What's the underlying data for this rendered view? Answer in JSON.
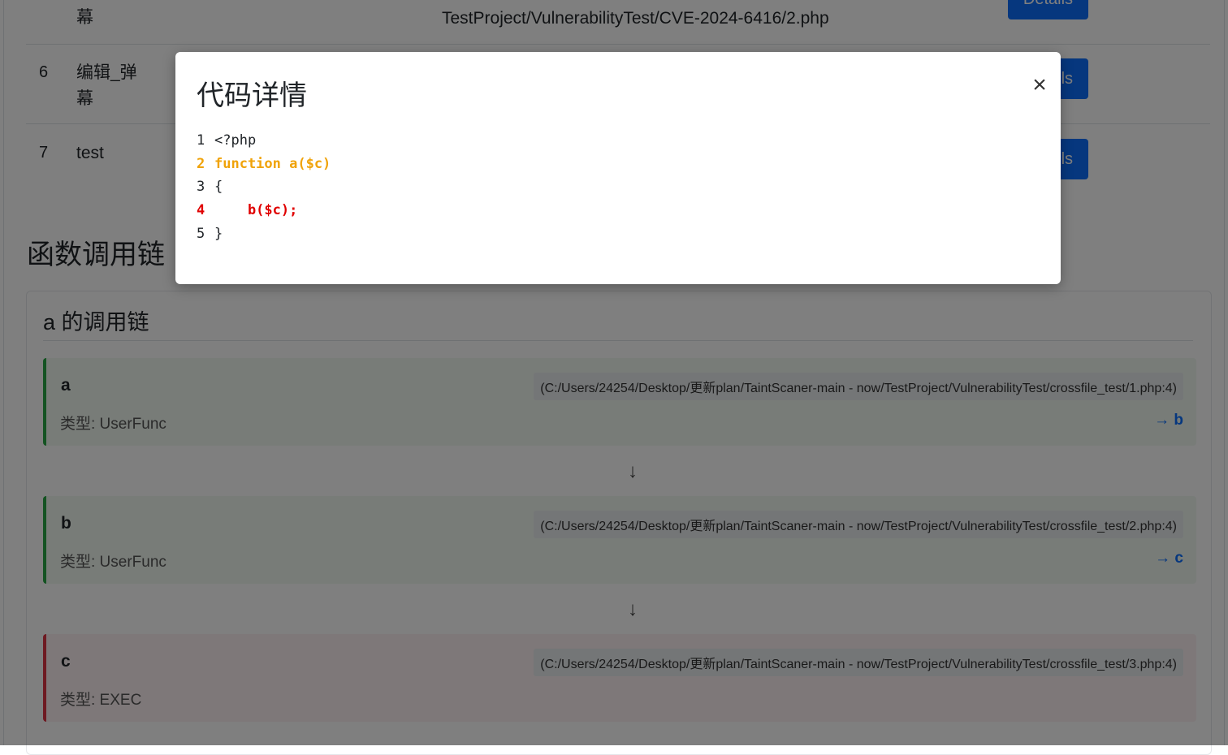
{
  "table": {
    "top_row": {
      "name_tail": "幕",
      "path": "TestProject/VulnerabilityTest/CVE-2024-6416/2.php",
      "button": "Details"
    },
    "rows": [
      {
        "num": "6",
        "name_line1": "编辑_弹",
        "name_line2": "幕",
        "button": "Details"
      },
      {
        "num": "7",
        "name_line1": "test",
        "name_line2": "",
        "button": "Details"
      }
    ]
  },
  "section_title": "函数调用链",
  "chain": {
    "title": "a 的调用链",
    "nodes": [
      {
        "name": "a",
        "path": "(C:/Users/24254/Desktop/更新plan/TaintScaner-main - now/TestProject/VulnerabilityTest/crossfile_test/1.php:4)",
        "type": "类型: UserFunc",
        "next": "→ b"
      },
      {
        "name": "b",
        "path": "(C:/Users/24254/Desktop/更新plan/TaintScaner-main - now/TestProject/VulnerabilityTest/crossfile_test/2.php:4)",
        "type": "类型: UserFunc",
        "next": "→ c"
      },
      {
        "name": "c",
        "path": "(C:/Users/24254/Desktop/更新plan/TaintScaner-main - now/TestProject/VulnerabilityTest/crossfile_test/3.php:4)",
        "type": "类型: EXEC",
        "next": ""
      }
    ],
    "arrow": "↓"
  },
  "modal": {
    "title": "代码详情",
    "close": "×",
    "lines": [
      {
        "n": "1",
        "text": "<?php"
      },
      {
        "n": "2",
        "text": "function a($c)"
      },
      {
        "n": "3",
        "text": "{"
      },
      {
        "n": "4",
        "text": "    b($c);"
      },
      {
        "n": "5",
        "text": "}"
      }
    ]
  },
  "colors": {
    "primary": "#0d6efd",
    "ok_border": "#28a745",
    "danger_border": "#dc3545",
    "highlight_orange": "#f0a30a",
    "highlight_red": "#e00000"
  }
}
